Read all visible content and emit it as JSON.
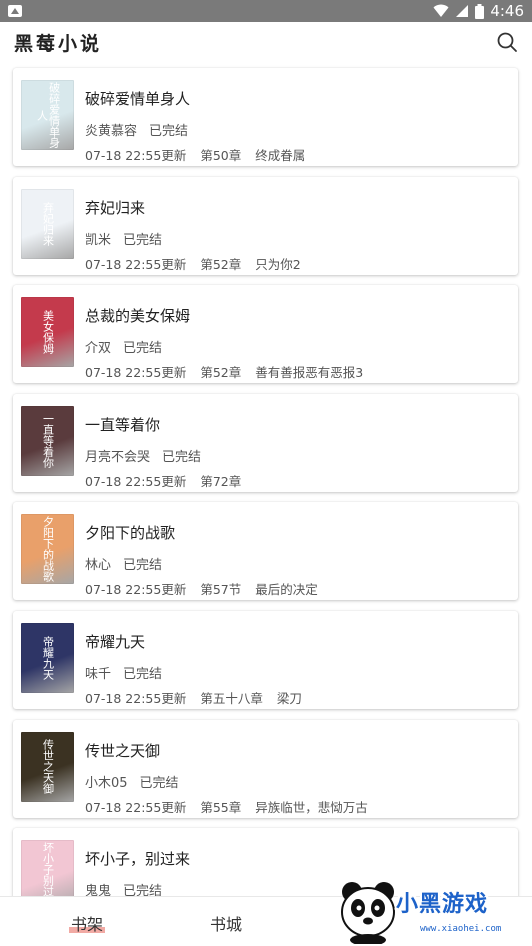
{
  "status_bar": {
    "time": "4:46"
  },
  "app_bar": {
    "title": "黑莓小说"
  },
  "books": [
    {
      "title": "破碎爱情单身人",
      "author": "炎黄慕容",
      "status": "已完结",
      "updated": "07-18 22:55更新",
      "chapter": "第50章",
      "chapter_title": "终成眷属",
      "cover_text": "破碎爱情单身人",
      "cover_color": "#d8e8ec"
    },
    {
      "title": "弃妃归来",
      "author": "凯米",
      "status": "已完结",
      "updated": "07-18 22:55更新",
      "chapter": "第52章",
      "chapter_title": "只为你2",
      "cover_text": "弃妃归来",
      "cover_color": "#eef2f6"
    },
    {
      "title": "总裁的美女保姆",
      "author": "介双",
      "status": "已完结",
      "updated": "07-18 22:55更新",
      "chapter": "第52章",
      "chapter_title": "善有善报恶有恶报3",
      "cover_text": "美女保姆",
      "cover_color": "#c43a4c"
    },
    {
      "title": "一直等着你",
      "author": "月亮不会哭",
      "status": "已完结",
      "updated": "07-18 22:55更新",
      "chapter": "第72章",
      "chapter_title": "",
      "cover_text": "一直等着你",
      "cover_color": "#5a3b3d"
    },
    {
      "title": "夕阳下的战歌",
      "author": "林心",
      "status": "已完结",
      "updated": "07-18 22:55更新",
      "chapter": "第57节",
      "chapter_title": "最后的决定",
      "cover_text": "夕阳下的战歌",
      "cover_color": "#e9a06a"
    },
    {
      "title": "帝耀九天",
      "author": "味千",
      "status": "已完结",
      "updated": "07-18 22:55更新",
      "chapter": "第五十八章",
      "chapter_title": "梁刀",
      "cover_text": "帝耀九天",
      "cover_color": "#2e3566"
    },
    {
      "title": "传世之天御",
      "author": "小木05",
      "status": "已完结",
      "updated": "07-18 22:55更新",
      "chapter": "第55章",
      "chapter_title": "异族临世，悲恸万古",
      "cover_text": "传世之天御",
      "cover_color": "#3b3222"
    },
    {
      "title": "坏小子，别过来",
      "author": "鬼鬼",
      "status": "已完结",
      "updated": "",
      "chapter": "",
      "chapter_title": "",
      "cover_text": "坏小子别过来",
      "cover_color": "#f2c6d3"
    }
  ],
  "bottom_nav": {
    "tabs": [
      {
        "label": "书架",
        "active": true
      },
      {
        "label": "书城",
        "active": false
      }
    ]
  },
  "watermark": {
    "text": "小黑游戏",
    "url": "www.xiaohei.com"
  }
}
